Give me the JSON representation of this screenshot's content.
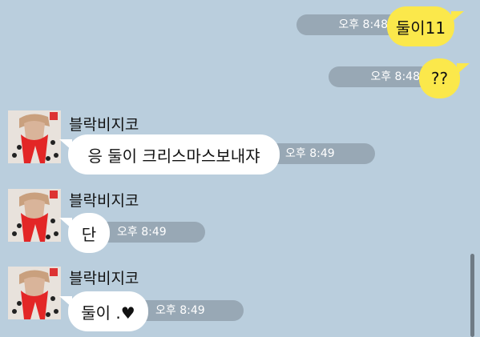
{
  "sent_messages": [
    {
      "text": "둘이11",
      "time": "오후 8:48"
    },
    {
      "text": "??",
      "time": "오후 8:48"
    }
  ],
  "received_messages": [
    {
      "sender": "블락비지코",
      "text": "응 둘이 크리스마스보내쟈",
      "time": "오후 8:49"
    },
    {
      "sender": "블락비지코",
      "text": "단",
      "time": "오후 8:49"
    },
    {
      "sender": "블락비지코",
      "text": "둘이 .♥",
      "time": "오후 8:49"
    }
  ],
  "colors": {
    "background": "#bacedd",
    "sent_bubble": "#fbe84b",
    "received_bubble": "#ffffff",
    "timestamp_pill": "#98a8b5"
  }
}
